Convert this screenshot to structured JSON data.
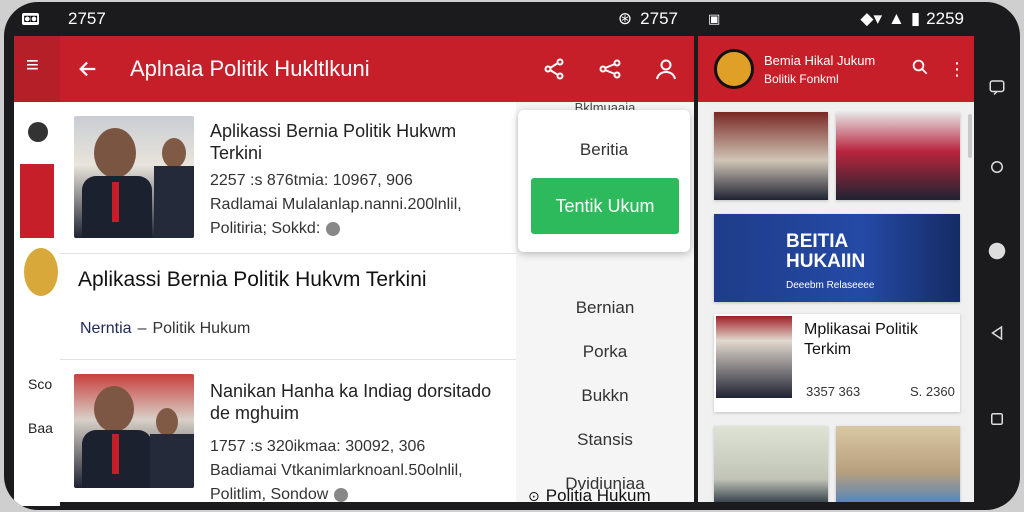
{
  "status_left": {
    "time": "2757"
  },
  "status_center": {
    "time": "2757"
  },
  "status_right": {
    "time": "2259"
  },
  "main": {
    "title": "Aplnaia Politik Hukltlkuni",
    "cards": [
      {
        "title": "Aplikassi Bernia Politik Hukwm Terkini",
        "line1": "2257 :s 876tmia: 10967, 906",
        "line2": "Radlamai Mulalanlap.nanni.200lnlil,",
        "line3": "Politiria; Sokkd:"
      },
      {
        "title": "Nanikan Hanha ka Indiag dorsitado de mghuim",
        "line1": "1757 :s 320ikmaa: 30092, 306",
        "line2": "Badiamai Vtkanimlarknoanl.50olnlil,",
        "line3": "Politlim, Sondow"
      }
    ],
    "feature": {
      "title": "Aplikassi Bernia Politik Hukvm Terkini",
      "category": "Nerntia",
      "separator": "–",
      "subcategory": "Politik Hukum"
    }
  },
  "menu": {
    "header_fragment": "Bklmuaaia",
    "items": [
      "Beritia",
      "Tentik Ukum",
      "Bernian",
      "Porka",
      "Bukkn",
      "Stansis",
      "Dvidiuniaa"
    ],
    "footer": "Politia Hukum"
  },
  "right": {
    "app_title": "Bemia Hikal Jukum",
    "app_subtitle": "Bolitik Fonkml",
    "banner_text": "BEITIA HUKAIIN",
    "banner_sub": "Deeebm Relaseeee",
    "card": {
      "title": "Mplikasai Politik Terkim",
      "left": "3357 363",
      "right": "S. 2360"
    }
  },
  "left_app": {
    "label1": "Sco",
    "label2": "Baa"
  },
  "colors": {
    "brand": "#c61f2a",
    "accent": "#2dba5c"
  }
}
